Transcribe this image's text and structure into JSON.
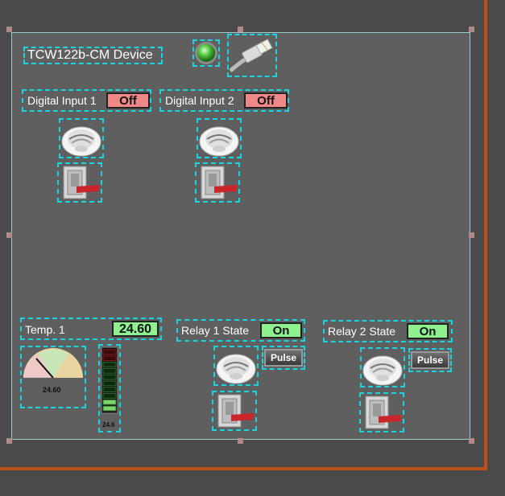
{
  "device": {
    "title": "TCW122b-CM Device"
  },
  "inputs": [
    {
      "label": "Digital Input 1",
      "state": "Off"
    },
    {
      "label": "Digital Input 2",
      "state": "Off"
    }
  ],
  "temperature": {
    "label": "Temp. 1",
    "value": "24.60",
    "gauge_value": "24.60",
    "bar_value": "24.6",
    "level_fraction": 0.2
  },
  "relays": [
    {
      "label": "Relay 1 State",
      "state": "On",
      "pulse_label": "Pulse"
    },
    {
      "label": "Relay 2 State",
      "state": "On",
      "pulse_label": "Pulse"
    }
  ],
  "colors": {
    "accent_border": "#17d6e0",
    "frame": "#c0501a",
    "off": "#f08888",
    "on": "#8ef08e"
  },
  "icons": [
    "status-led-icon",
    "ethernet-cable-icon",
    "smoke-detector-icon",
    "door-switch-icon"
  ]
}
